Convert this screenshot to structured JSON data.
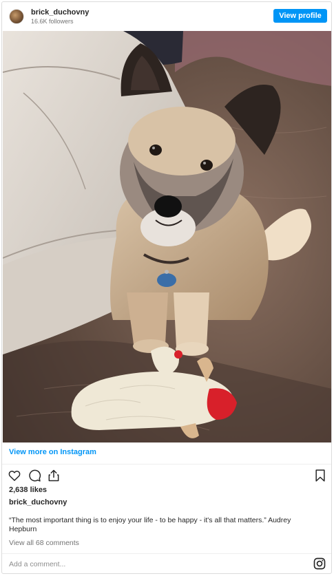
{
  "header": {
    "username": "brick_duchovny",
    "followers": "16.6K followers",
    "view_profile_label": "View profile"
  },
  "post": {
    "image_subject": "dog-photo",
    "view_more_label": "View more on Instagram",
    "likes": "2,638 likes",
    "caption_user": "brick_duchovny",
    "caption_text": "“The most important thing is to enjoy your life - to be happy - it's all that matters.” Audrey Hepburn",
    "comments_link": "View all 68 comments",
    "add_comment_placeholder": "Add a comment...",
    "icons": [
      "heart-icon",
      "comment-icon",
      "share-icon",
      "bookmark-icon",
      "instagram-icon"
    ]
  },
  "colors": {
    "accent": "#0095f6",
    "text": "#262626",
    "muted": "#737373",
    "border": "#dbdbdb"
  }
}
